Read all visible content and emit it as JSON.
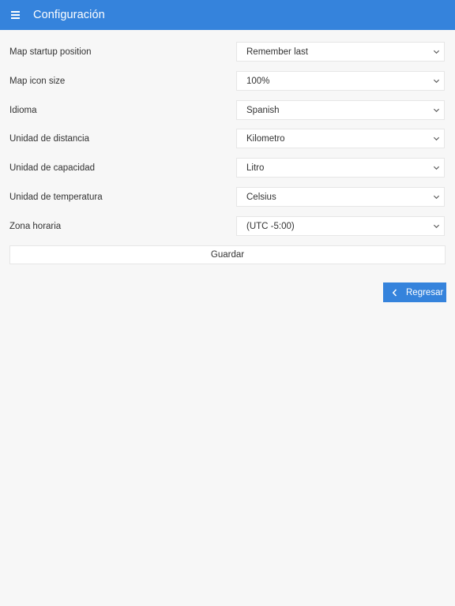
{
  "header": {
    "title": "Configuración",
    "menu_icon": "hamburger-menu-icon",
    "background": "#3583dc"
  },
  "settings": [
    {
      "label": "Map startup position",
      "value": "Remember last"
    },
    {
      "label": "Map icon size",
      "value": "100%"
    },
    {
      "label": "Idioma",
      "value": "Spanish"
    },
    {
      "label": "Unidad de distancia",
      "value": "Kilometro"
    },
    {
      "label": "Unidad de capacidad",
      "value": "Litro"
    },
    {
      "label": "Unidad de temperatura",
      "value": "Celsius"
    },
    {
      "label": "Zona horaria",
      "value": "(UTC -5:00)"
    }
  ],
  "actions": {
    "save_label": "Guardar",
    "back_label": "Regresar",
    "back_icon": "chevron-left-icon"
  },
  "colors": {
    "accent": "#3583dc",
    "page_background": "#f7f7f7"
  }
}
